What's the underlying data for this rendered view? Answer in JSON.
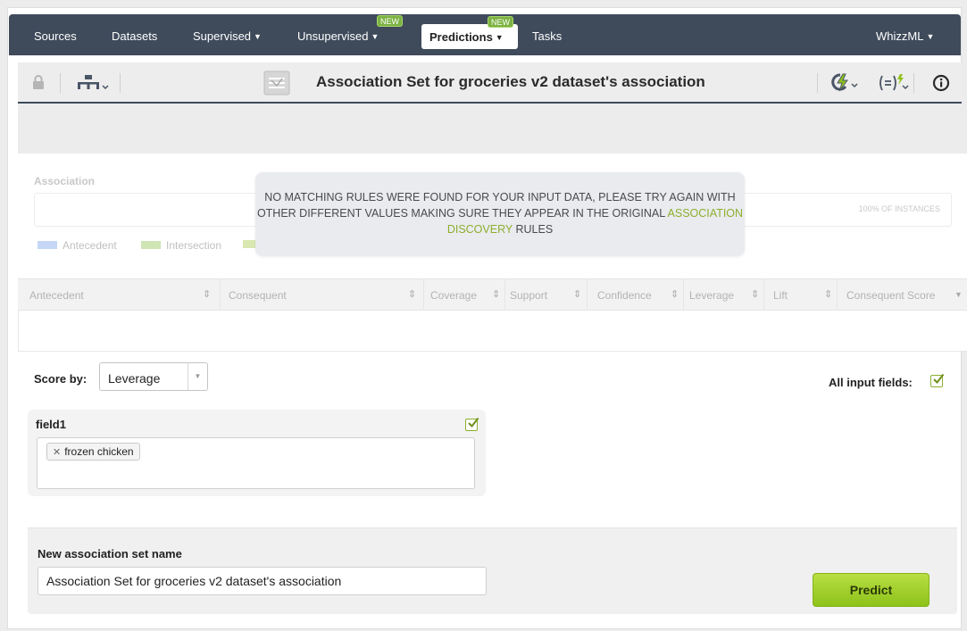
{
  "nav": {
    "items": [
      {
        "label": "Sources"
      },
      {
        "label": "Datasets"
      },
      {
        "label": "Supervised"
      },
      {
        "label": "Unsupervised",
        "badge": "NEW"
      },
      {
        "label": "Predictions",
        "badge": "NEW",
        "active": true
      },
      {
        "label": "Tasks"
      }
    ],
    "user": "WhizzML",
    "caret": "▼"
  },
  "toolbar": {
    "title": "Association Set for groceries v2 dataset's association",
    "icons": [
      "lock-icon",
      "model-tree-icon",
      "association-set-icon",
      "batch-predict-icon",
      "formula-icon",
      "info-icon"
    ]
  },
  "association": {
    "label": "Association",
    "instances": "100% OF INSTANCES",
    "legend": [
      "Antecedent",
      "Intersection"
    ],
    "legend_colors": [
      "#c5d6f7",
      "#cfe5b4"
    ]
  },
  "message": {
    "part1": "NO MATCHING RULES WERE FOUND FOR YOUR INPUT DATA, PLEASE TRY AGAIN WITH OTHER DIFFERENT VALUES MAKING SURE THEY APPEAR IN THE ORIGINAL",
    "link": "ASSOCIATION DISCOVERY",
    "part2": "RULES"
  },
  "table": {
    "columns": [
      "Antecedent",
      "Consequent",
      "Coverage",
      "Support",
      "Confidence",
      "Leverage",
      "Lift",
      "Consequent Score"
    ]
  },
  "controls": {
    "score_by_label": "Score by:",
    "score_by_value": "Leverage",
    "all_input_fields_label": "All input fields:"
  },
  "field": {
    "name": "field1",
    "tag": "frozen chicken"
  },
  "form": {
    "name_label": "New association set name",
    "name_value": "Association Set for groceries v2 dataset's association",
    "predict_label": "Predict"
  },
  "colors": {
    "nav_bg": "#3f4b5b",
    "accent_green": "#8ec21a",
    "highlight": "#8fae2c"
  }
}
